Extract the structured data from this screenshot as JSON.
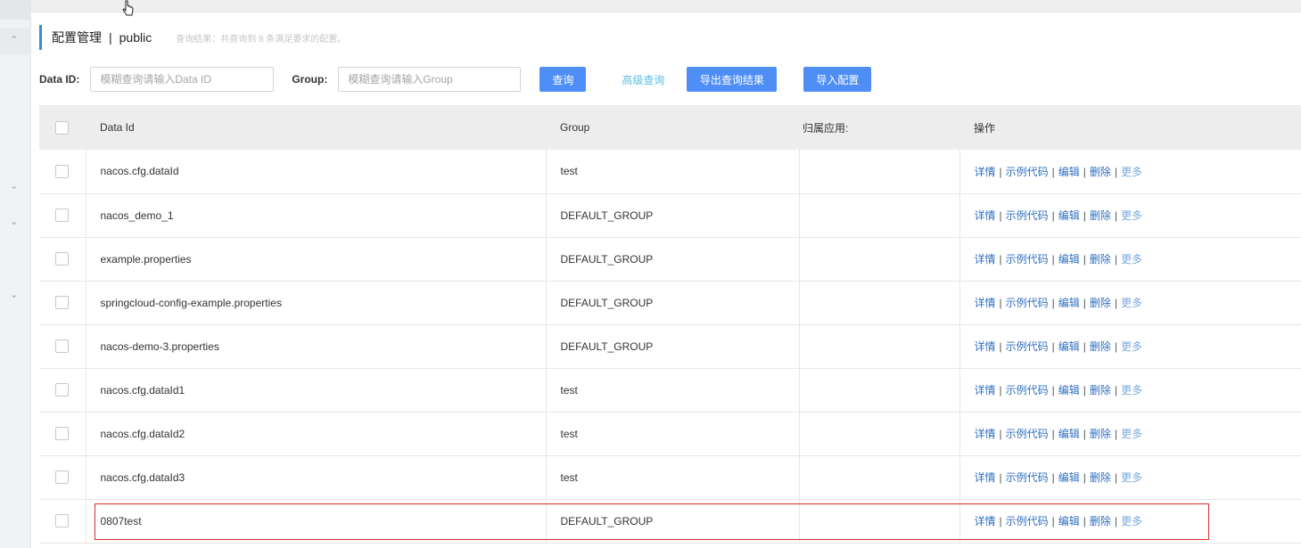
{
  "header": {
    "title": "配置管理",
    "separator": "|",
    "namespace": "public",
    "summary": "查询结果：共查询到 8 条满足要求的配置。"
  },
  "search": {
    "data_id_label": "Data ID:",
    "data_id_placeholder": "模糊查询请输入Data ID",
    "group_label": "Group:",
    "group_placeholder": "模糊查询请输入Group",
    "query_button": "查询",
    "advanced_link": "高级查询",
    "export_button": "导出查询结果",
    "import_button": "导入配置"
  },
  "table": {
    "columns": [
      "Data Id",
      "Group",
      "归属应用:",
      "操作"
    ],
    "operations": [
      "详情",
      "示例代码",
      "编辑",
      "删除",
      "更多"
    ],
    "rows": [
      {
        "data_id": "nacos.cfg.dataId",
        "group": "test",
        "app": ""
      },
      {
        "data_id": "nacos_demo_1",
        "group": "DEFAULT_GROUP",
        "app": ""
      },
      {
        "data_id": "example.properties",
        "group": "DEFAULT_GROUP",
        "app": ""
      },
      {
        "data_id": "springcloud-config-example.properties",
        "group": "DEFAULT_GROUP",
        "app": ""
      },
      {
        "data_id": "nacos-demo-3.properties",
        "group": "DEFAULT_GROUP",
        "app": ""
      },
      {
        "data_id": "nacos.cfg.dataId1",
        "group": "test",
        "app": ""
      },
      {
        "data_id": "nacos.cfg.dataId2",
        "group": "test",
        "app": ""
      },
      {
        "data_id": "nacos.cfg.dataId3",
        "group": "test",
        "app": ""
      },
      {
        "data_id": "0807test",
        "group": "DEFAULT_GROUP",
        "app": ""
      }
    ]
  },
  "sidebar": {
    "icons": [
      "chevron-up-icon",
      "chevron-down-icon",
      "chevron-down-icon",
      "chevron-down-icon"
    ]
  },
  "colors": {
    "primary_button": "#4f8ef7",
    "accent_bar": "#3b89d8",
    "link": "#2f6fc0",
    "highlight_border": "#e02b2b"
  }
}
